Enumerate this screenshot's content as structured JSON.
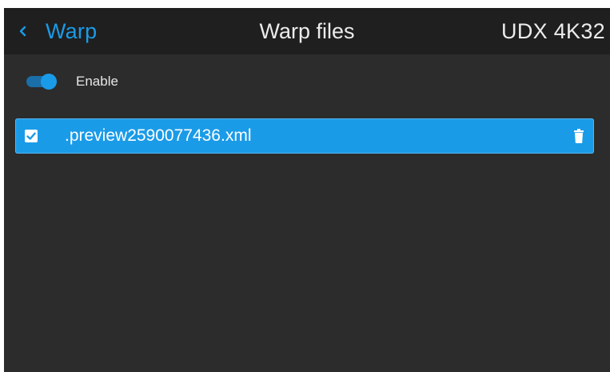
{
  "header": {
    "back_label": "Warp",
    "title": "Warp files",
    "device": "UDX 4K32"
  },
  "enable": {
    "label": "Enable",
    "state": "on"
  },
  "files": [
    {
      "name": ".preview2590077436.xml",
      "checked": true,
      "selected": true
    }
  ],
  "colors": {
    "accent": "#1a9be8",
    "background": "#2c2c2c",
    "header_background": "#1f1f1f",
    "text": "#ececec"
  },
  "icons": {
    "back": "chevron-left-icon",
    "delete": "trash-icon",
    "check": "checkbox-checked-icon"
  }
}
